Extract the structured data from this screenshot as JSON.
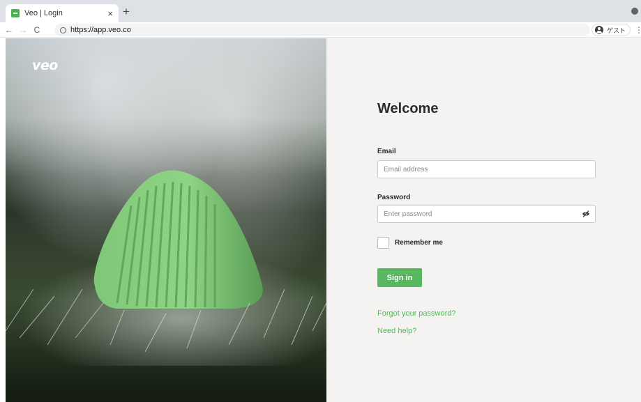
{
  "browser": {
    "tab_title": "Veo | Login",
    "tab_close": "×",
    "new_tab": "+",
    "nav": {
      "back": "←",
      "forward": "→",
      "reload": "C"
    },
    "url": "https://app.veo.co",
    "guest_label": "ゲスト",
    "menu": "⋮"
  },
  "hero": {
    "logo": "veo"
  },
  "login": {
    "heading": "Welcome",
    "email_label": "Email",
    "email_placeholder": "Email address",
    "email_value": "",
    "password_label": "Password",
    "password_placeholder": "Enter password",
    "password_value": "",
    "remember_label": "Remember me",
    "remember_checked": false,
    "signin_label": "Sign in",
    "forgot_link": "Forgot your password?",
    "help_link": "Need help?"
  },
  "colors": {
    "accent": "#58b75f",
    "form_background": "#f4f3f1",
    "heading_text": "#2b2b2b"
  },
  "icons": [
    "favicon-icon",
    "close-icon",
    "plus-icon",
    "back-arrow-icon",
    "forward-arrow-icon",
    "reload-icon",
    "site-info-icon",
    "guest-avatar-icon",
    "menu-dots-icon",
    "eye-slash-icon"
  ]
}
